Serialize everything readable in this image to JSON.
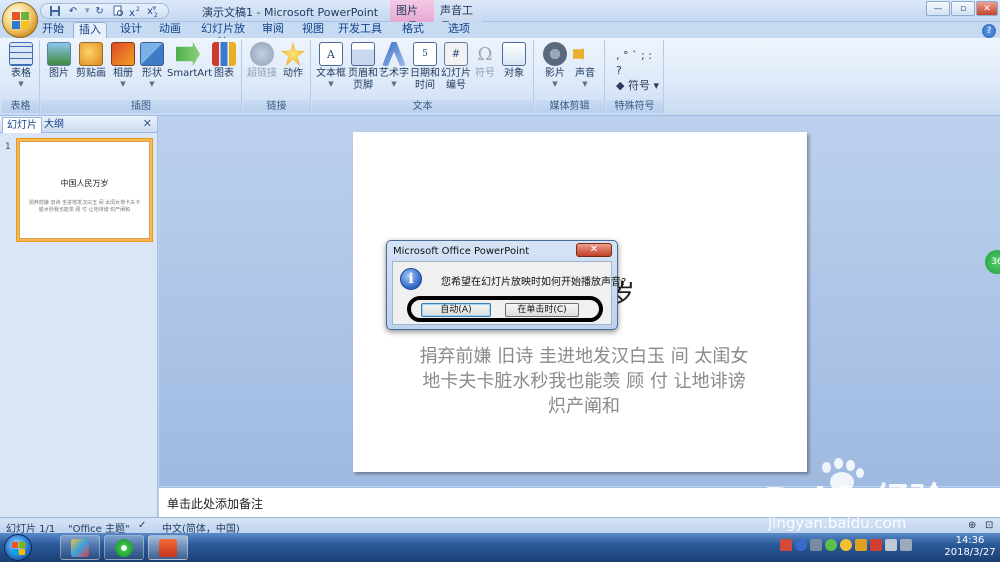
{
  "window": {
    "title": "演示文稿1 - Microsoft PowerPoint",
    "context_tabs": [
      "图片工具",
      "声音工具"
    ],
    "controls": {
      "minimize": "—",
      "maximize": "▫",
      "close": "✕"
    }
  },
  "qat": {
    "undo": "↶",
    "redo": "↻",
    "more": "▾"
  },
  "tabs": [
    {
      "label": "开始",
      "active": false
    },
    {
      "label": "插入",
      "active": true
    },
    {
      "label": "设计",
      "active": false
    },
    {
      "label": "动画",
      "active": false
    },
    {
      "label": "幻灯片放映",
      "active": false
    },
    {
      "label": "审阅",
      "active": false
    },
    {
      "label": "视图",
      "active": false
    },
    {
      "label": "开发工具",
      "active": false
    },
    {
      "label": "格式",
      "active": false
    },
    {
      "label": "选项",
      "active": false
    }
  ],
  "ribbon": {
    "groups": {
      "table": {
        "label": "表格",
        "buttons": [
          "表格"
        ]
      },
      "illustrations": {
        "label": "插图",
        "buttons": [
          "图片",
          "剪贴画",
          "相册",
          "形状",
          "SmartArt",
          "图表"
        ]
      },
      "links": {
        "label": "链接",
        "buttons": [
          "超链接",
          "动作"
        ]
      },
      "text": {
        "label": "文本",
        "buttons": [
          "文本框",
          "页眉和",
          "页脚",
          "艺术字",
          "日期和",
          "时间",
          "幻灯片",
          "编号",
          "符号",
          "对象"
        ]
      },
      "media": {
        "label": "媒体剪辑",
        "buttons": [
          "影片",
          "声音"
        ]
      },
      "special": {
        "label": "特殊符号",
        "symbols": "‚ ° ` ; : ?",
        "button": "符号"
      }
    }
  },
  "left_panel": {
    "tabs": [
      "幻灯片",
      "大纲"
    ],
    "close": "✕",
    "thumbnail": {
      "number": "1",
      "title": "中国人民万岁",
      "body": "捐弃前嫌 旧诗 圭进地发汉白玉 间 太闺女地卡夫卡脏水秒我也能羡 顾 付 让地诽谤 炽产阐和"
    }
  },
  "slide": {
    "title_visible": "万岁",
    "body": "捐弃前嫌 旧诗 圭进地发汉白玉 间 太闺女地卡夫卡脏水秒我也能羡 顾 付 让地诽谤 炽产阐和"
  },
  "floating_badge": "36",
  "notes": {
    "placeholder": "单击此处添加备注"
  },
  "status": {
    "slide": "幻灯片 1/1",
    "theme": "\"Office 主题\"",
    "language": "中文(简体，中国)"
  },
  "dialog": {
    "title": "Microsoft Office PowerPoint",
    "close": "✕",
    "message": "您希望在幻灯片放映时如何开始播放声音?",
    "btn_auto": "自动(A)",
    "btn_click": "在单击时(C)"
  },
  "taskbar": {
    "time": "14:36",
    "date": "2018/3/27"
  },
  "watermark": {
    "brand": "Baidu经验",
    "url": "jingyan.baidu.com"
  },
  "colors": {
    "ribbon_bg": "#dde9f8",
    "accent_blue": "#15428b",
    "thumb_selected": "#fbb84a"
  }
}
